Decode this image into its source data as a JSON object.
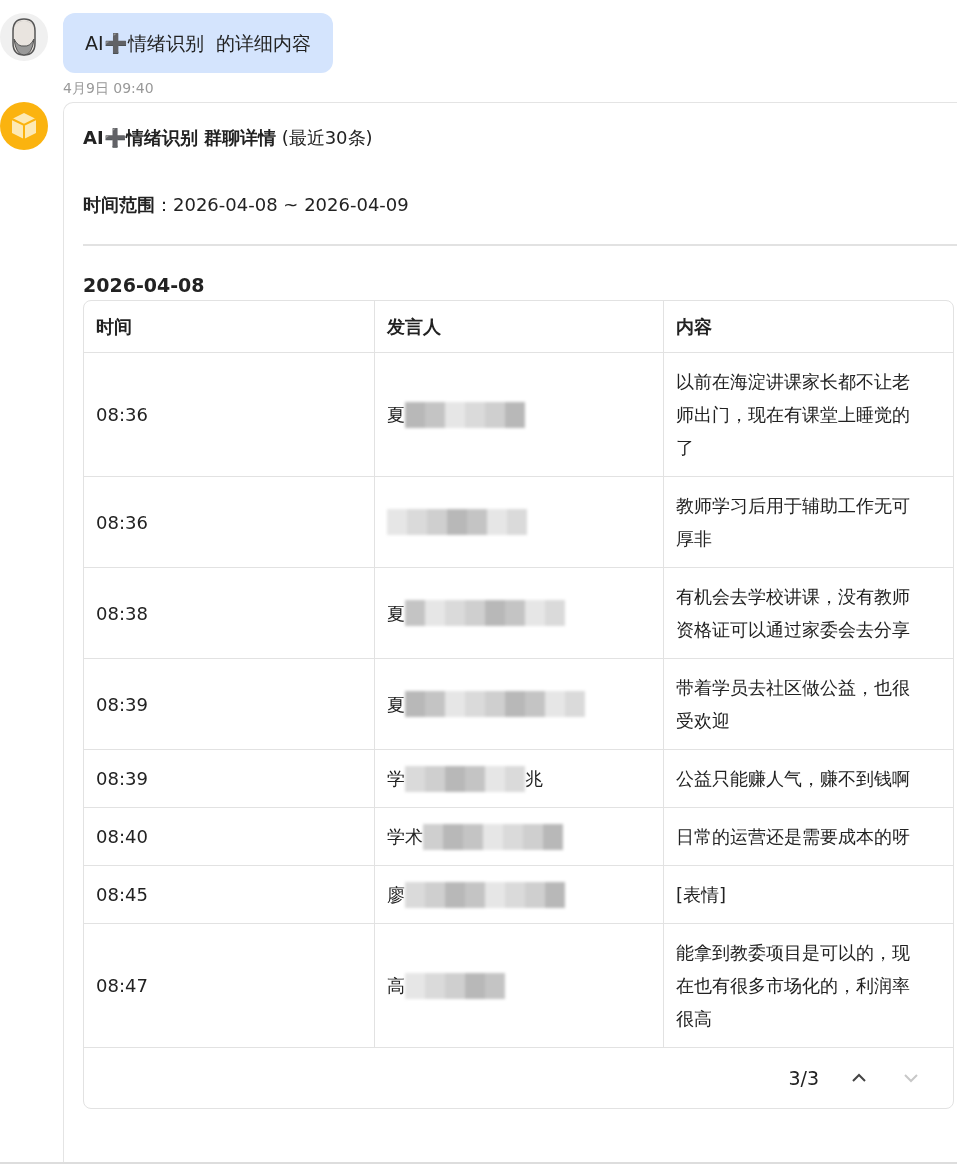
{
  "user_message": {
    "text": "AI➕情绪识别  的详细内容",
    "time": "4月9日 09:40"
  },
  "reply": {
    "title": "**AI➕情绪识别 群聊详情** (最近30条)",
    "range": "**时间范围**：2026-04-08 ~ 2026-04-09",
    "date": "2026-04-08",
    "table": {
      "columns": [
        "时间",
        "发言人",
        "内容"
      ],
      "rows": [
        {
          "time": "08:36",
          "speaker_start": "夏",
          "content": "以前在海淀讲课家长都不让老师出门，现在有课堂上睡觉的了"
        },
        {
          "time": "08:36",
          "content": "教师学习后用于辅助工作无可厚非"
        },
        {
          "time": "08:38",
          "speaker_start": "夏",
          "content": "有机会去学校讲课，没有教师资格证可以通过家委会去分享"
        },
        {
          "time": "08:39",
          "speaker_start": "夏",
          "content": "带着学员去社区做公益，也很受欢迎"
        },
        {
          "time": "08:39",
          "speaker_start": "学",
          "speaker_end": "兆",
          "content": "公益只能赚人气，赚不到钱啊"
        },
        {
          "time": "08:40",
          "speaker_start": "学术",
          "content": "日常的运营还是需要成本的呀"
        },
        {
          "time": "08:45",
          "speaker_start": "廖",
          "content": "[表情]"
        },
        {
          "time": "08:47",
          "speaker_start": "高",
          "content": "能拿到教委项目是可以的，现在也有很多市场化的，利润率很高"
        }
      ]
    },
    "pager": {
      "text": "3/3",
      "prev_disabled": false,
      "next_disabled": true
    }
  }
}
